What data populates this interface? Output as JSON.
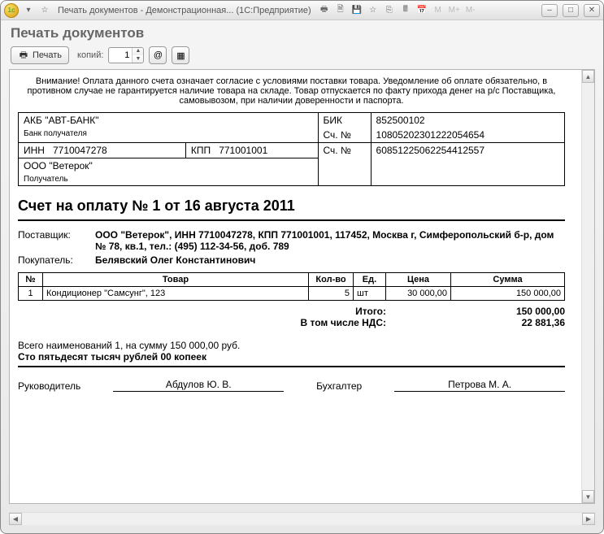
{
  "titlebar": {
    "title": "Печать документов - Демонстрационная...  (1С:Предприятие)",
    "mem_labels": [
      "M",
      "M+",
      "M-"
    ]
  },
  "caption": "Печать документов",
  "toolbar": {
    "print_label": "Печать",
    "copies_label": "копий:",
    "copies_value": "1"
  },
  "warning": "Внимание! Оплата данного счета означает согласие с условиями поставки товара. Уведомление об оплате обязательно, в противном случае не гарантируется наличие товара на складе. Товар отпускается по факту прихода денег на р/с Поставщика, самовывозом, при наличии доверенности и паспорта.",
  "bank": {
    "bank_name": "АКБ \"АВТ-БАНК\"",
    "bank_sub": "Банк получателя",
    "bik_label": "БИК",
    "bik": "852500102",
    "acc_label1": "Сч. №",
    "corr_acc": "10805202301222054654",
    "inn_label": "ИНН",
    "inn": "7710047278",
    "kpp_label": "КПП",
    "kpp": "771001001",
    "acc_label2": "Сч. №",
    "acc": "60851225062254412557",
    "payee": "ООО \"Ветерок\"",
    "payee_sub": "Получатель"
  },
  "doc_title": "Счет на оплату № 1 от 16 августа 2011",
  "supplier": {
    "label": "Поставщик:",
    "value": "ООО \"Ветерок\", ИНН 7710047278, КПП 771001001, 117452, Москва г, Симферопольский б-р, дом № 78, кв.1, тел.: (495) 112-34-56, доб. 789"
  },
  "buyer": {
    "label": "Покупатель:",
    "value": "Белявский Олег Константинович"
  },
  "items": {
    "headers": {
      "num": "№",
      "name": "Товар",
      "qty": "Кол-во",
      "unit": "Ед.",
      "price": "Цена",
      "sum": "Сумма"
    },
    "rows": [
      {
        "num": "1",
        "name": "Кондиционер \"Самсунг\", 123",
        "qty": "5",
        "unit": "шт",
        "price": "30 000,00",
        "sum": "150 000,00"
      }
    ]
  },
  "totals": {
    "total_label": "Итого:",
    "total": "150 000,00",
    "vat_label": "В том числе НДС:",
    "vat": "22 881,36"
  },
  "summary": {
    "line1": "Всего наименований 1, на сумму 150 000,00 руб.",
    "line2": "Сто пятьдесят тысяч рублей 00 копеек"
  },
  "sign": {
    "director_label": "Руководитель",
    "director_name": "Абдулов Ю. В.",
    "accountant_label": "Бухгалтер",
    "accountant_name": "Петрова М. А."
  }
}
